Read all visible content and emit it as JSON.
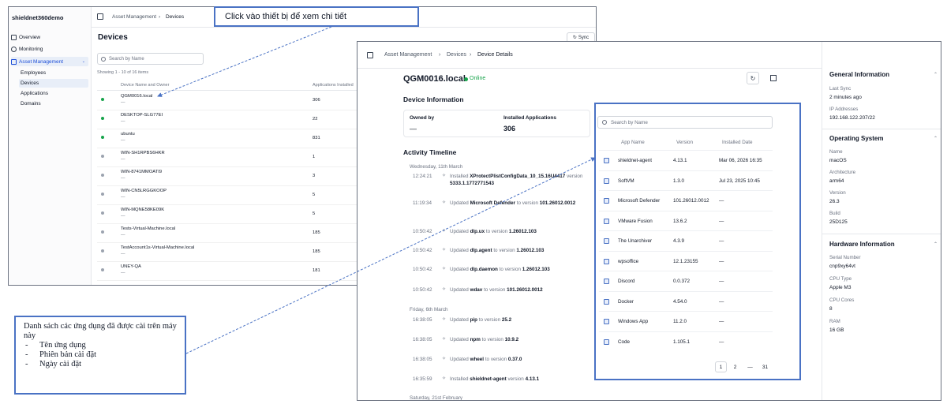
{
  "back_window": {
    "org_name": "shieldnet360demo",
    "nav": {
      "overview": "Overview",
      "monitoring": "Monitoring",
      "asset_management": "Asset Management",
      "employees": "Employees",
      "devices": "Devices",
      "applications": "Applications",
      "domains": "Domains"
    },
    "breadcrumb": [
      "Asset Management",
      "Devices"
    ],
    "title": "Devices",
    "sync_label": "Sync",
    "search_placeholder": "Search by Name",
    "showing": "Showing 1 - 10 of 16 items",
    "columns": [
      "Device Name and Owner",
      "Applications Installed"
    ],
    "devices": [
      {
        "name": "QGM0016.local",
        "owner": "—",
        "apps": "306",
        "online": true
      },
      {
        "name": "DESKTOP-SLG77EI",
        "owner": "—",
        "apps": "22",
        "online": true
      },
      {
        "name": "ubuntu",
        "owner": "—",
        "apps": "831",
        "online": true
      },
      {
        "name": "WIN-SH1RPBS6HKR",
        "owner": "—",
        "apps": "1",
        "online": false
      },
      {
        "name": "WIN-8741MMOATI9",
        "owner": "—",
        "apps": "3",
        "online": false
      },
      {
        "name": "WIN-CN5LRGGKOOP",
        "owner": "—",
        "apps": "5",
        "online": false
      },
      {
        "name": "WIN-MQNE58KE09K",
        "owner": "—",
        "apps": "5",
        "online": false
      },
      {
        "name": "Tests-Virtual-Machine.local",
        "owner": "—",
        "apps": "185",
        "online": false
      },
      {
        "name": "TestAccount1s-Virtual-Machine.local",
        "owner": "—",
        "apps": "185",
        "online": false
      },
      {
        "name": "UNEY-QA",
        "owner": "—",
        "apps": "181",
        "online": false
      }
    ]
  },
  "front_window": {
    "breadcrumb": [
      "Asset Management",
      "Devices",
      "Device Details"
    ],
    "device_name": "QGM0016.local",
    "status": "Online",
    "device_info_title": "Device Information",
    "owned_by_label": "Owned by",
    "owned_by_value": "—",
    "installed_apps_label": "Installed Applications",
    "installed_apps_value": "306",
    "timeline_title": "Activity Timeline",
    "timeline": {
      "date1": "Wednesday, 11th March",
      "date2": "Friday, 6th March",
      "date3": "Saturday, 21st February",
      "entries": [
        {
          "time": "12:24:21",
          "verb": "Installed",
          "app": "XProtectPlistConfigData_10_15.16U4417",
          "tail": "version",
          "ver": "5333.1.1772771543"
        },
        {
          "time": "11:19:34",
          "verb": "Updated",
          "app": "Microsoft Defender",
          "tail": "to version",
          "ver": "101.26012.0012"
        },
        {
          "time": "10:50:42",
          "verb": "Updated",
          "app": "dlp.ux",
          "tail": "to version",
          "ver": "1.26012.103"
        },
        {
          "time": "10:50:42",
          "verb": "Updated",
          "app": "dlp.agent",
          "tail": "to version",
          "ver": "1.26012.103"
        },
        {
          "time": "10:50:42",
          "verb": "Updated",
          "app": "dlp.daemon",
          "tail": "to version",
          "ver": "1.26012.103"
        },
        {
          "time": "10:50:42",
          "verb": "Updated",
          "app": "wdav",
          "tail": "to version",
          "ver": "101.26012.0012"
        },
        {
          "time": "16:38:05",
          "verb": "Updated",
          "app": "pip",
          "tail": "to version",
          "ver": "25.2"
        },
        {
          "time": "16:38:05",
          "verb": "Updated",
          "app": "npm",
          "tail": "to version",
          "ver": "10.9.2"
        },
        {
          "time": "16:38:05",
          "verb": "Updated",
          "app": "wheel",
          "tail": "to version",
          "ver": "0.37.0"
        },
        {
          "time": "16:35:59",
          "verb": "Installed",
          "app": "shieldnet-agent",
          "tail": "version",
          "ver": "4.13.1"
        }
      ]
    },
    "apps": {
      "search_placeholder": "Search by Name",
      "columns": [
        "App Name",
        "Version",
        "Installed Date"
      ],
      "rows": [
        {
          "name": "shieldnet-agent",
          "version": "4.13.1",
          "date": "Mar 06, 2026 16:35"
        },
        {
          "name": "SoftVM",
          "version": "1.3.0",
          "date": "Jul 23, 2025 10:45"
        },
        {
          "name": "Microsoft Defender",
          "version": "101.26012.0012",
          "date": "—"
        },
        {
          "name": "VMware Fusion",
          "version": "13.6.2",
          "date": "—"
        },
        {
          "name": "The Unarchiver",
          "version": "4.3.9",
          "date": "—"
        },
        {
          "name": "wpsoffice",
          "version": "12.1.23155",
          "date": "—"
        },
        {
          "name": "Discord",
          "version": "0.0.372",
          "date": "—"
        },
        {
          "name": "Docker",
          "version": "4.54.0",
          "date": "—"
        },
        {
          "name": "Windows App",
          "version": "11.2.0",
          "date": "—"
        },
        {
          "name": "Code",
          "version": "1.105.1",
          "date": "—"
        }
      ],
      "pages": [
        "1",
        "2",
        "—",
        "31"
      ]
    },
    "right_panel": {
      "general": {
        "title": "General Information",
        "last_sync_label": "Last Sync",
        "last_sync_value": "2 minutes ago",
        "ip_label": "IP Addresses",
        "ip_value": "192.168.122.207/22"
      },
      "os": {
        "title": "Operating System",
        "name_label": "Name",
        "name_value": "macOS",
        "arch_label": "Architecture",
        "arch_value": "arm64",
        "version_label": "Version",
        "version_value": "26.3",
        "build_label": "Build",
        "build_value": "25D125"
      },
      "hardware": {
        "title": "Hardware Information",
        "serial_label": "Serial Number",
        "serial_value": "cnp9xy64vt",
        "cpu_type_label": "CPU Type",
        "cpu_type_value": "Apple M3",
        "cpu_cores_label": "CPU Cores",
        "cpu_cores_value": "8",
        "ram_label": "RAM",
        "ram_value": "16 GB"
      }
    }
  },
  "annotations": {
    "callout1": "Click vào thiết bị để xem chi tiết",
    "callout2_title": "Danh sách các ứng dụng đã được cài trên máy này",
    "callout2_items": [
      "Tên ứng dụng",
      "Phiên bản cài đặt",
      "Ngày cài đặt"
    ]
  },
  "colors": {
    "accent": "#4a72c4",
    "online": "#16a34a",
    "offline": "#9ca3af"
  }
}
